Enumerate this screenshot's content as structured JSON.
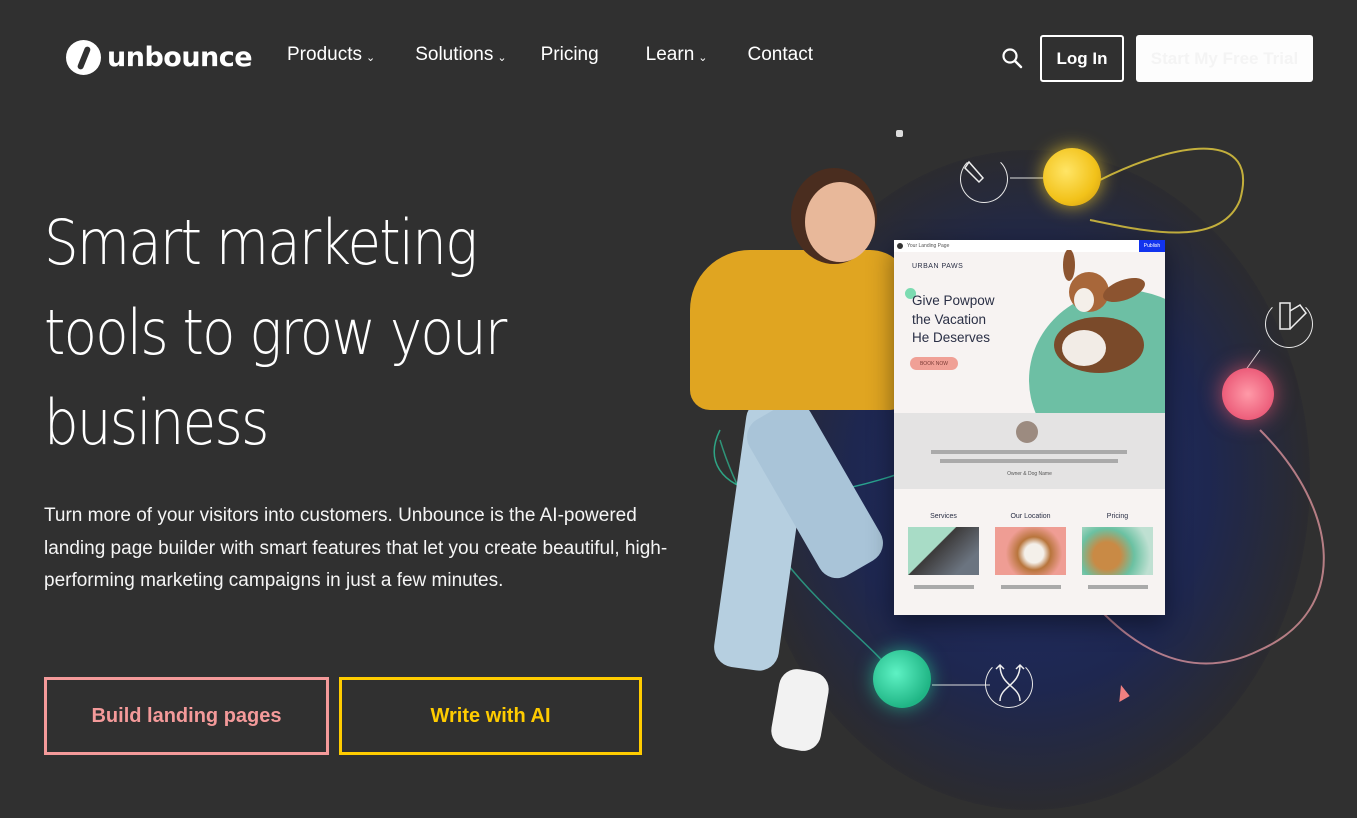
{
  "brand": {
    "name": "unbounce"
  },
  "nav": {
    "items": [
      {
        "label": "Products",
        "has_dropdown": true
      },
      {
        "label": "Solutions",
        "has_dropdown": true
      },
      {
        "label": "Pricing",
        "has_dropdown": false
      },
      {
        "label": "Learn",
        "has_dropdown": true
      },
      {
        "label": "Contact",
        "has_dropdown": false
      }
    ],
    "chevron": "⌄",
    "search_icon": "search-icon",
    "login_label": "Log In",
    "trial_label": "Start My Free Trial"
  },
  "hero": {
    "headline_lines": [
      "Smart marketing",
      "tools to grow your",
      "business"
    ],
    "description": "Turn more of your visitors into customers. Unbounce is the AI-powered landing page builder with smart features that let you create beautiful, high-performing marketing campaigns in just a few minutes.",
    "primary_cta": "Build landing pages",
    "secondary_cta": "Write with AI"
  },
  "colors": {
    "background": "#303030",
    "primary_cta": "#f49a9a",
    "secondary_cta": "#ffcc00",
    "text": "#ffffff"
  },
  "mockup": {
    "tab_title": "Your Landing Page",
    "publish_label": "Publish",
    "brand": "URBAN PAWS",
    "title_lines": [
      "Give Powpow",
      "the Vacation",
      "He Deserves"
    ],
    "cta": "BOOK NOW",
    "testimonial_caption": "Owner & Dog Name",
    "columns": [
      {
        "label": "Services"
      },
      {
        "label": "Our Location"
      },
      {
        "label": "Pricing"
      }
    ]
  },
  "illustration": {
    "icons": [
      "pen-tool-icon",
      "palette-swatch-icon",
      "split-arrows-icon"
    ]
  }
}
